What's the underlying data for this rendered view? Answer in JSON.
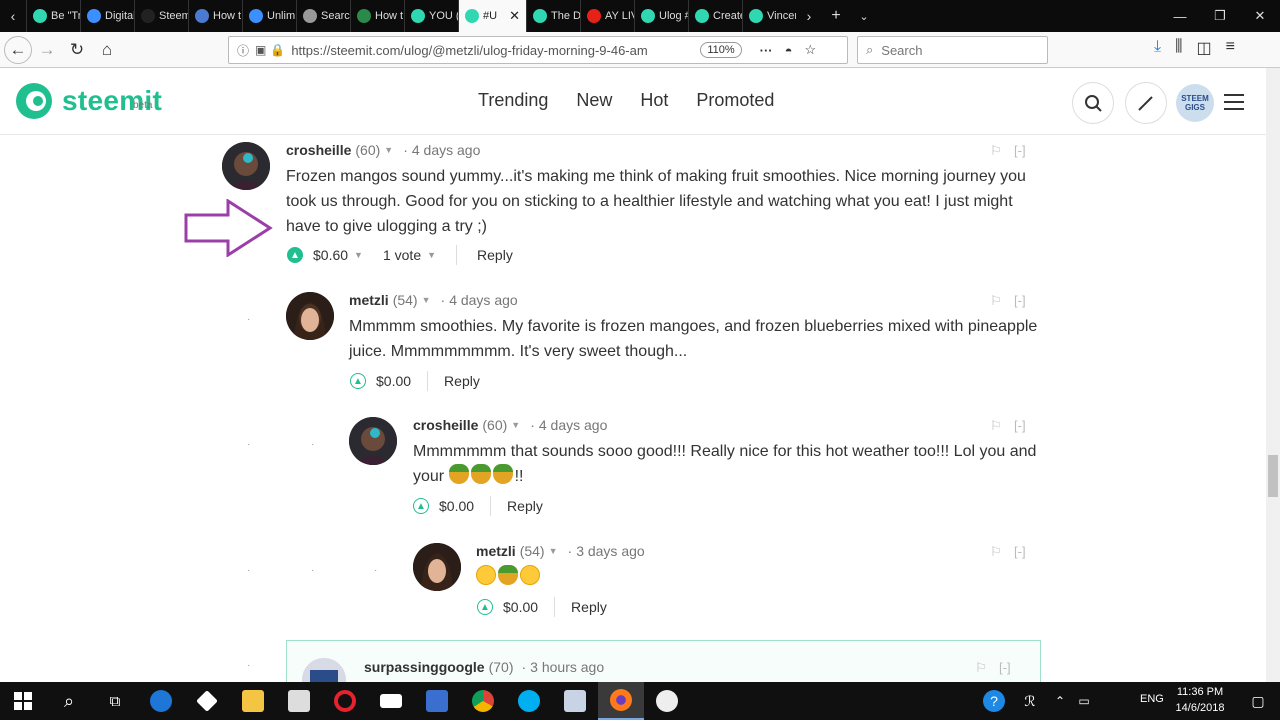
{
  "browser": {
    "tabs": [
      {
        "title": "Be \"Tr",
        "color": "#2fd8b0"
      },
      {
        "title": "Digital",
        "color": "#3b8fff"
      },
      {
        "title": "Steem",
        "color": "#222"
      },
      {
        "title": "How t",
        "color": "#4a7bd0"
      },
      {
        "title": "Unlim",
        "color": "#3b8fff"
      },
      {
        "title": "Search",
        "color": "#999"
      },
      {
        "title": "How t",
        "color": "#2a8a4a"
      },
      {
        "title": "YOU (",
        "color": "#2fd8b0"
      },
      {
        "title": "#U",
        "color": "#2fd8b0",
        "active": true
      },
      {
        "title": "The D",
        "color": "#2fd8b0"
      },
      {
        "title": "AY LIV",
        "color": "#e62117"
      },
      {
        "title": "Ulog #",
        "color": "#2fd8b0"
      },
      {
        "title": "Create",
        "color": "#2fd8b0"
      },
      {
        "title": "Vincer",
        "color": "#2fd8b0"
      }
    ],
    "url": "https://steemit.com/ulog/@metzli/ulog-friday-morning-9-46-am",
    "zoom": "110%",
    "search_placeholder": "Search"
  },
  "site": {
    "logo_text": "steemit",
    "beta": "beta",
    "nav": [
      "Trending",
      "New",
      "Hot",
      "Promoted"
    ],
    "user_avatar_text": "STEEM GIGS"
  },
  "comments": [
    {
      "author": "crosheille",
      "rep": "(60)",
      "time": "4 days ago",
      "body": "Frozen mangos sound yummy...it's making me think of making fruit smoothies. Nice morning journey you took us through. Good for you on sticking to a healthier lifestyle and watching what you eat! I just might have to give ulogging a try ;)",
      "payout": "$0.60",
      "votes": "1 vote",
      "reply": "Reply"
    },
    {
      "author": "metzli",
      "rep": "(54)",
      "time": "4 days ago",
      "body": "Mmmmm smoothies. My favorite is frozen mangoes, and frozen blueberries mixed with pineapple juice. Mmmmmmmmm. It's very sweet though...",
      "payout": "$0.00",
      "reply": "Reply"
    },
    {
      "author": "crosheille",
      "rep": "(60)",
      "time": "4 days ago",
      "body_line1": "Mmmmmmm that sounds sooo good!!! Really nice for this hot weather too!!! Lol you and",
      "body_line2_prefix": "your",
      "body_line2_suffix": "!!",
      "payout": "$0.00",
      "reply": "Reply"
    },
    {
      "author": "metzli",
      "rep": "(54)",
      "time": "3 days ago",
      "payout": "$0.00",
      "reply": "Reply"
    },
    {
      "author": "surpassinggoogle",
      "rep": "(70)",
      "time": "3 hours ago"
    }
  ],
  "common": {
    "flag": "⚐",
    "collapse": "[-]",
    "dot": "·"
  },
  "taskbar": {
    "lang": "ENG",
    "time": "11:36 PM",
    "date": "14/6/2018"
  },
  "colors": {
    "accent": "#1fbf8f",
    "arrow": "#9b3fa8"
  }
}
